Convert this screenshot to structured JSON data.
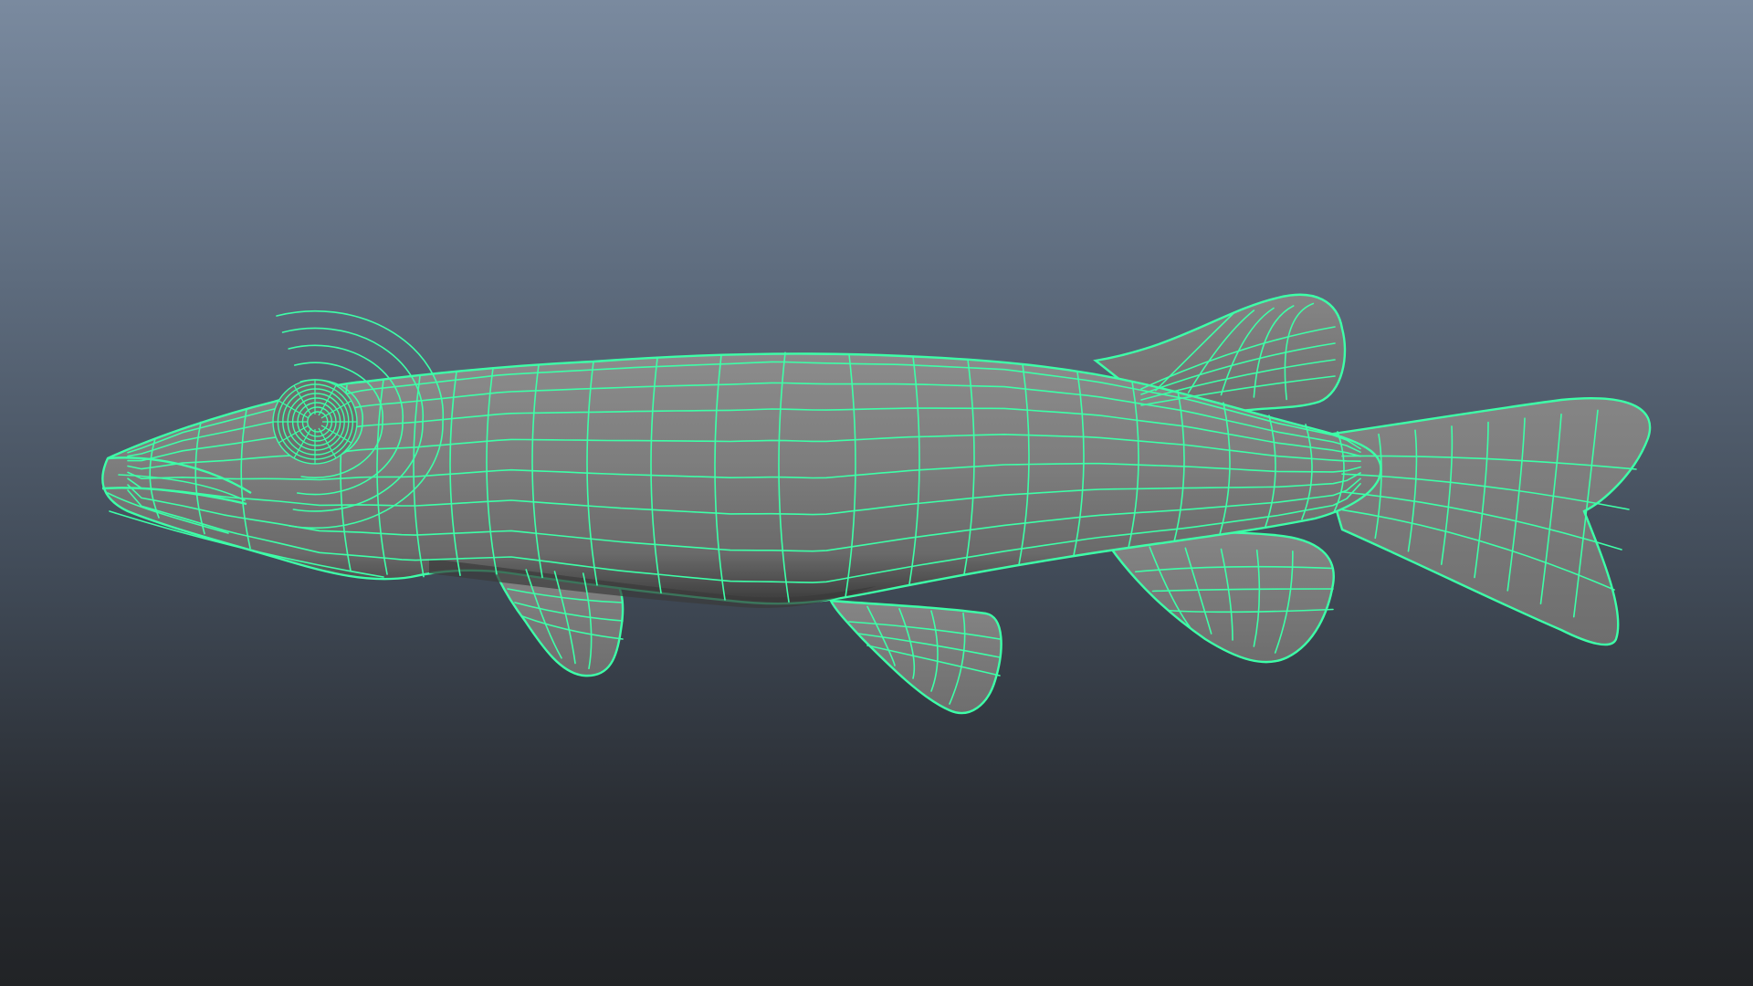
{
  "viewport": {
    "background_top": "#7a8a9f",
    "background_bottom": "#212326"
  },
  "model": {
    "wireframe_color": "#3dffa8",
    "surface_color": "#7a7a7a",
    "shadow_color": "#3e3e3e"
  }
}
